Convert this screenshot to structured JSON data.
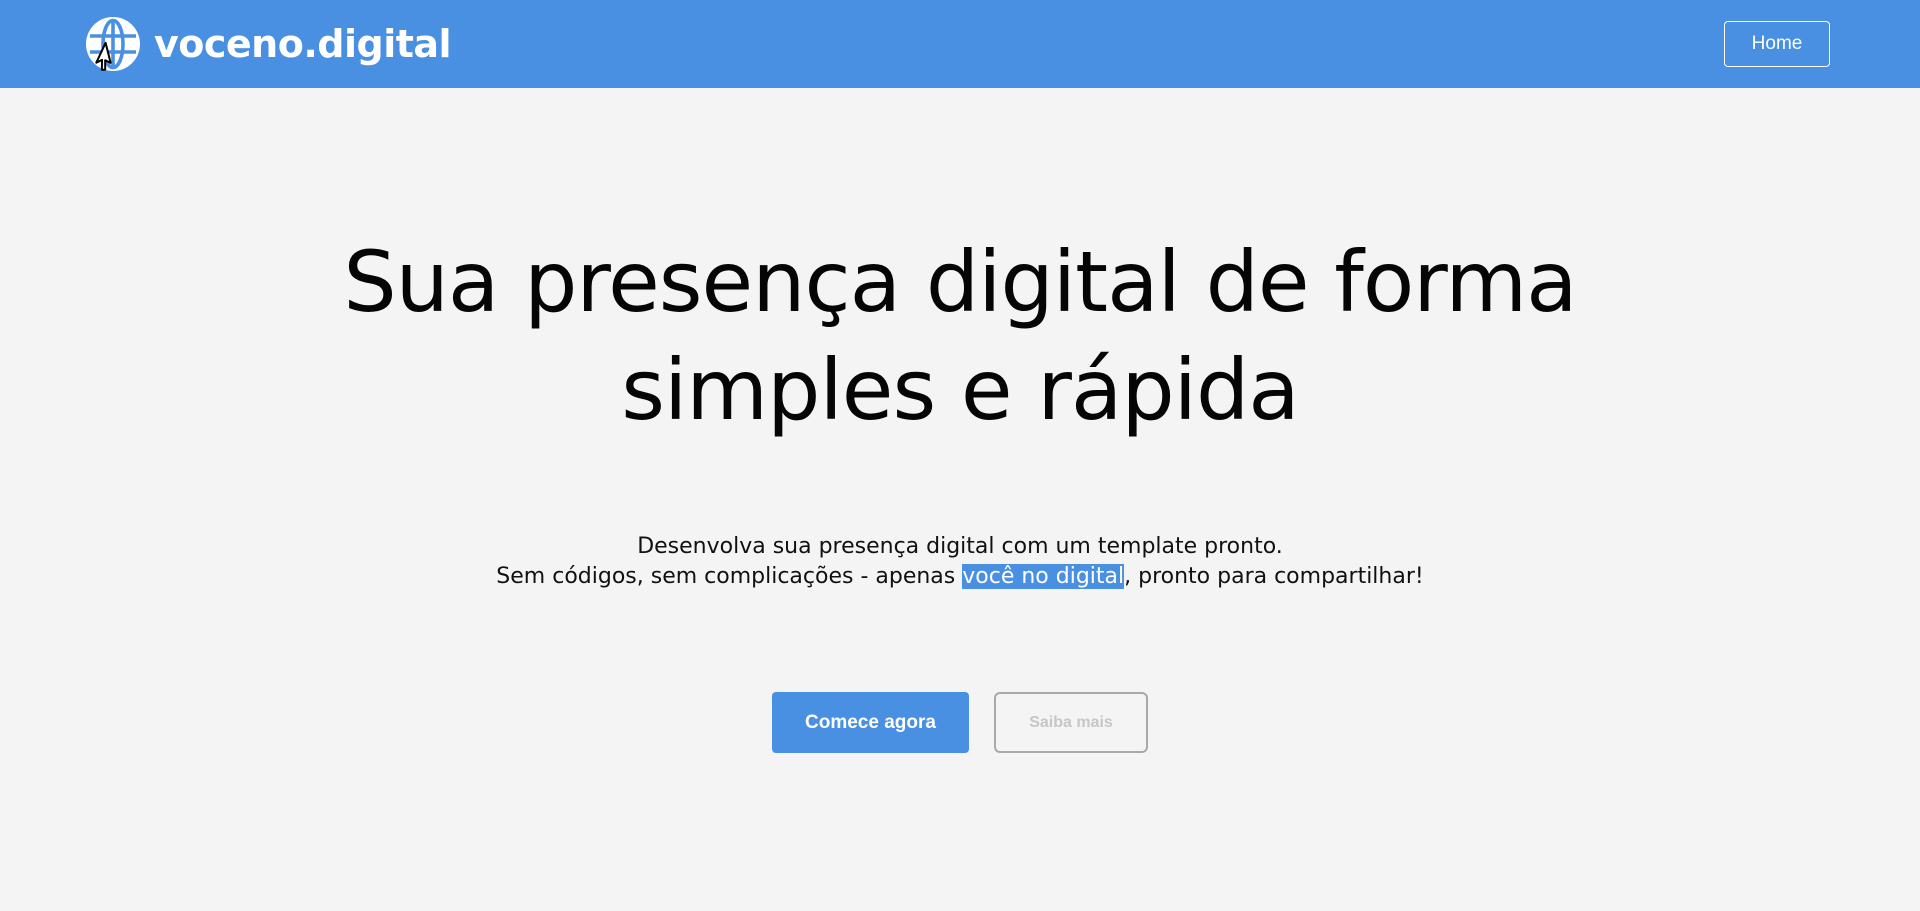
{
  "header": {
    "brand": "voceno.digital",
    "logo_icon": "globe-icon",
    "nav_home": "Home",
    "color": "#4a90e2"
  },
  "hero": {
    "title_line1": "Sua presença digital de forma",
    "title_line2": "simples e rápida",
    "subtitle_line1": "Desenvolva sua presença digital com um template pronto.",
    "subtitle_line2_before": "Sem códigos, sem complicações - apenas ",
    "subtitle_line2_highlight": "você no digital",
    "subtitle_line2_after": ", pronto para compartilhar!"
  },
  "actions": {
    "primary_label": "Comece agora",
    "secondary_label": "Saiba mais"
  },
  "colors": {
    "accent": "#4a90e2",
    "background": "#f4f4f4",
    "text": "#050505"
  }
}
